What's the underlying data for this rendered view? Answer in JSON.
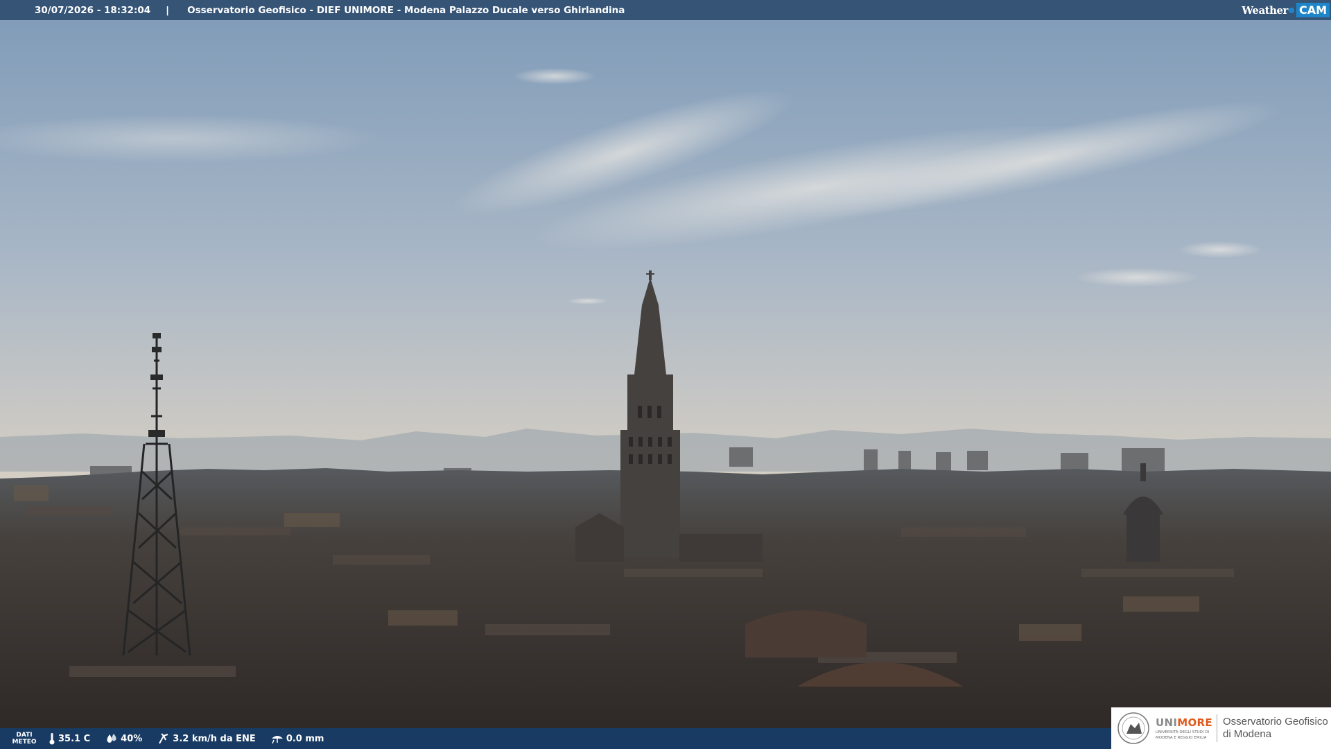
{
  "header": {
    "datetime": "30/07/2026 - 18:32:04",
    "separator": "|",
    "title": "Osservatorio Geofisico - DIEF UNIMORE - Modena Palazzo Ducale verso Ghirlandina",
    "brand_weather": "Weather",
    "brand_cam": "CAM"
  },
  "weather": {
    "label_line1": "DATI",
    "label_line2": "METEO",
    "temperature": "35.1 C",
    "humidity": "40%",
    "wind": "3.2 km/h da ENE",
    "rain": "0.0 mm",
    "icons": [
      "thermometer-icon",
      "humidity-drop-icon",
      "wind-icon",
      "rain-icon"
    ]
  },
  "logo": {
    "uni_prefix": "UNI",
    "uni_suffix": "MORE",
    "uni_sub1": "UNIVERSITÀ DEGLI STUDI DI",
    "uni_sub2": "MODENA E REGGIO EMILIA",
    "observatory_line1": "Osservatorio Geofisico",
    "observatory_line2": "di Modena"
  },
  "colors": {
    "sky_top": "#7e9ab8",
    "sky_bottom": "#d8d2c8",
    "city": "#3a3532",
    "topbar": "#2f4e70",
    "unimore_orange": "#e05a1c",
    "weathercam_blue": "#1e86c8"
  }
}
